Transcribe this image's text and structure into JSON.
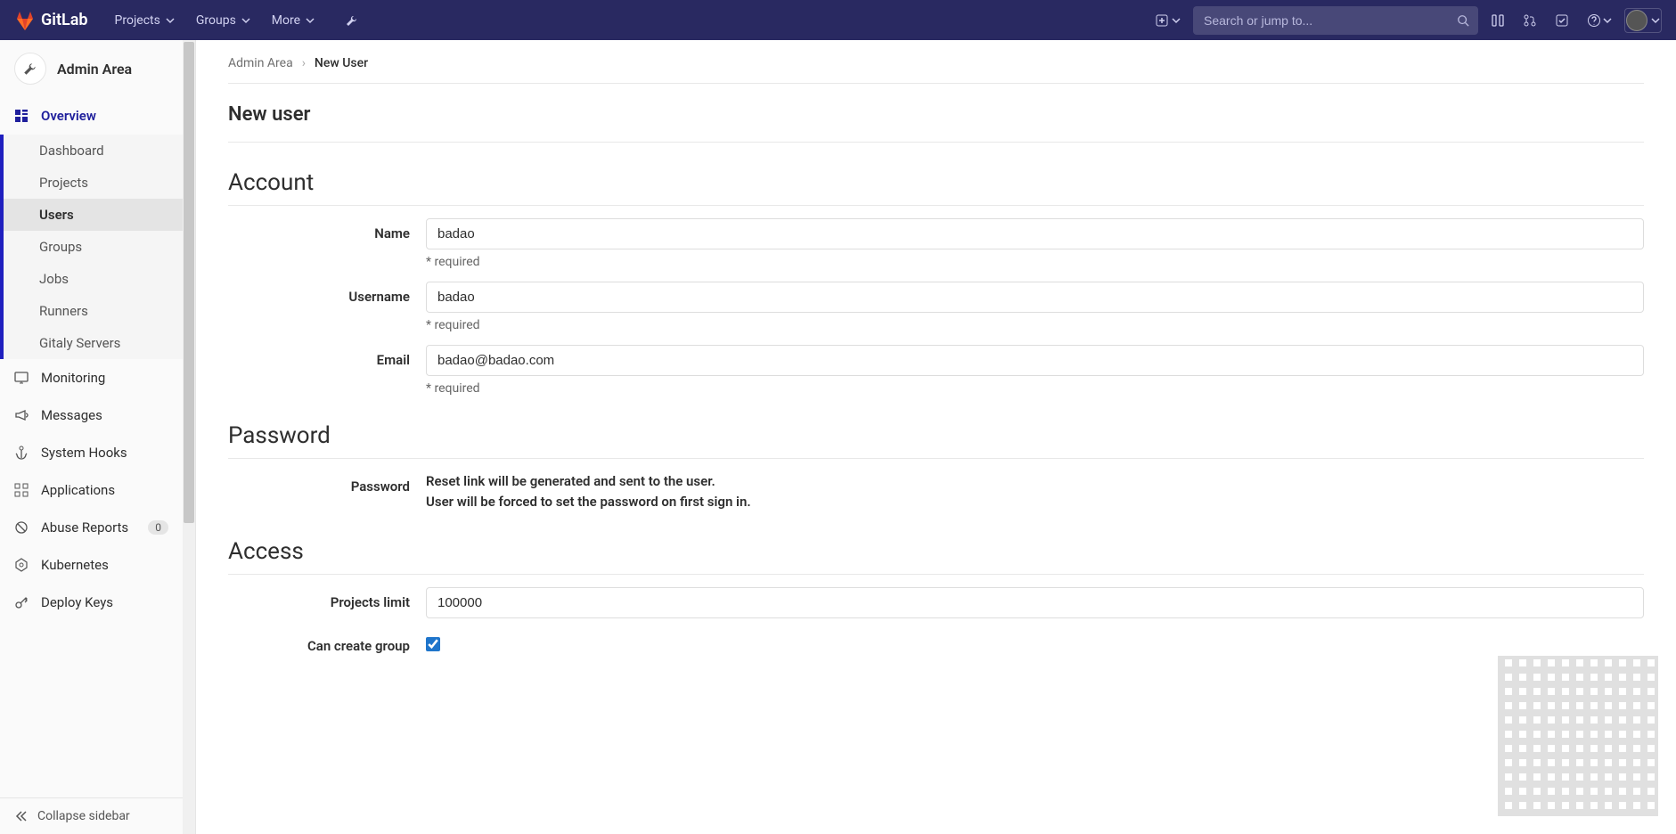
{
  "header": {
    "brand": "GitLab",
    "nav": [
      "Projects",
      "Groups",
      "More"
    ],
    "search_placeholder": "Search or jump to..."
  },
  "sidebar": {
    "area": "Admin Area",
    "top": {
      "label": "Overview",
      "items": [
        "Dashboard",
        "Projects",
        "Users",
        "Groups",
        "Jobs",
        "Runners",
        "Gitaly Servers"
      ],
      "active": "Users"
    },
    "sections": [
      {
        "icon": "monitor",
        "label": "Monitoring"
      },
      {
        "icon": "bullhorn",
        "label": "Messages"
      },
      {
        "icon": "anchor",
        "label": "System Hooks"
      },
      {
        "icon": "apps",
        "label": "Applications"
      },
      {
        "icon": "circle-slash",
        "label": "Abuse Reports",
        "badge": "0"
      },
      {
        "icon": "kubernetes",
        "label": "Kubernetes"
      },
      {
        "icon": "key",
        "label": "Deploy Keys"
      }
    ],
    "collapse": "Collapse sidebar"
  },
  "breadcrumb": {
    "root": "Admin Area",
    "current": "New User"
  },
  "page": {
    "title": "New user"
  },
  "account": {
    "heading": "Account",
    "name_label": "Name",
    "name_value": "badao",
    "username_label": "Username",
    "username_value": "badao",
    "email_label": "Email",
    "email_value": "badao@badao.com",
    "required_hint": "* required"
  },
  "password": {
    "heading": "Password",
    "label": "Password",
    "line1": "Reset link will be generated and sent to the user.",
    "line2": "User will be forced to set the password on first sign in."
  },
  "access": {
    "heading": "Access",
    "projects_limit_label": "Projects limit",
    "projects_limit_value": "100000",
    "can_create_group_label": "Can create group",
    "can_create_group_checked": true
  }
}
